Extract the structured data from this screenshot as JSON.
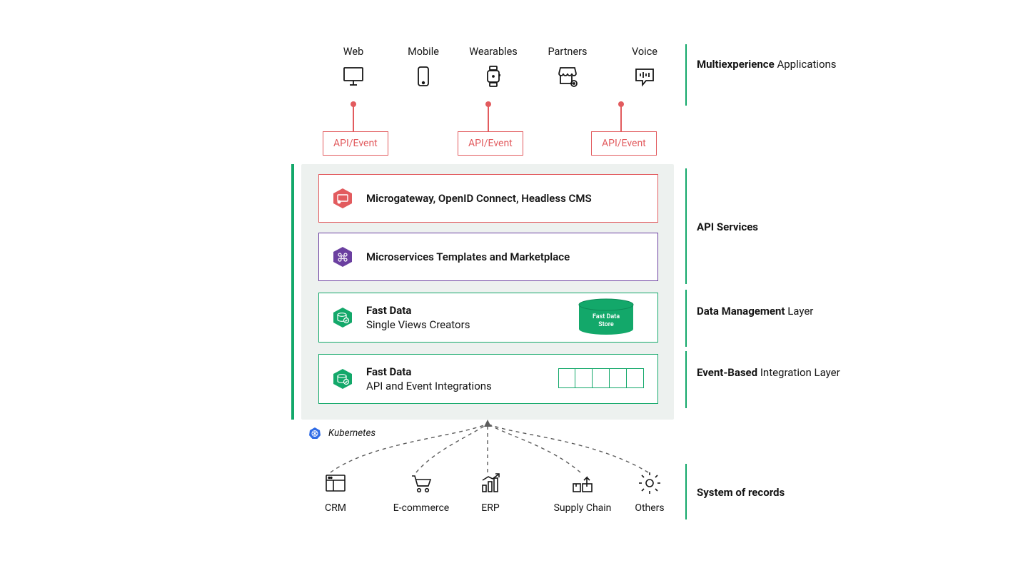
{
  "top_apps": {
    "items": [
      {
        "label": "Web"
      },
      {
        "label": "Mobile"
      },
      {
        "label": "Wearables"
      },
      {
        "label": "Partners"
      },
      {
        "label": "Voice"
      }
    ],
    "section_label_bold": "Multiexperience",
    "section_label_plain": "Applications"
  },
  "api_event_label": "API/Event",
  "api_layer": {
    "card_gateway": "Microgateway, OpenID Connect, Headless CMS",
    "card_marketplace": "Microservices Templates and Marketplace",
    "section_label_bold": "API Services"
  },
  "data_layer": {
    "card_title": "Fast Data",
    "card_sub": "Single Views Creators",
    "store_label_1": "Fast Data",
    "store_label_2": "Store",
    "section_label_bold": "Data Management",
    "section_label_plain": "Layer"
  },
  "event_layer": {
    "card_title": "Fast Data",
    "card_sub": "API and Event Integrations",
    "section_label_bold": "Event-Based",
    "section_label_plain": "Integration Layer"
  },
  "kubernetes_label": "Kubernetes",
  "records": {
    "items": [
      {
        "label": "CRM"
      },
      {
        "label": "E-commerce"
      },
      {
        "label": "ERP"
      },
      {
        "label": "Supply Chain"
      },
      {
        "label": "Others"
      }
    ],
    "section_label": "System of records"
  }
}
